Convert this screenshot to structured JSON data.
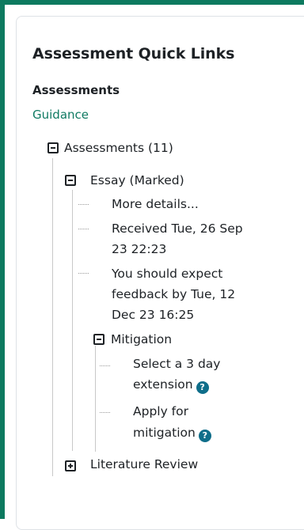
{
  "block": {
    "title": "Assessment Quick Links",
    "section_heading": "Assessments",
    "guidance_link": "Guidance"
  },
  "tree": {
    "root_label": "Assessments (11)",
    "essay_label": "Essay (Marked)",
    "more_details": "More details...",
    "received_line1": "Received Tue, 26 Sep",
    "received_line2": "23 22:23",
    "feedback_line1": "You should expect",
    "feedback_line2": "feedback by Tue, 12",
    "feedback_line3": "Dec 23 16:25",
    "mitigation_label": "Mitigation",
    "extension_line1": "Select a 3 day",
    "extension_line2": "extension",
    "apply_line1": "Apply for",
    "apply_line2": "mitigation",
    "literature_label": "Literature Review"
  },
  "icons": {
    "help_glyph": "?",
    "help_color": "#0f6e8a",
    "link_color": "#0f7a62",
    "frame_color": "#0d7a5f"
  }
}
